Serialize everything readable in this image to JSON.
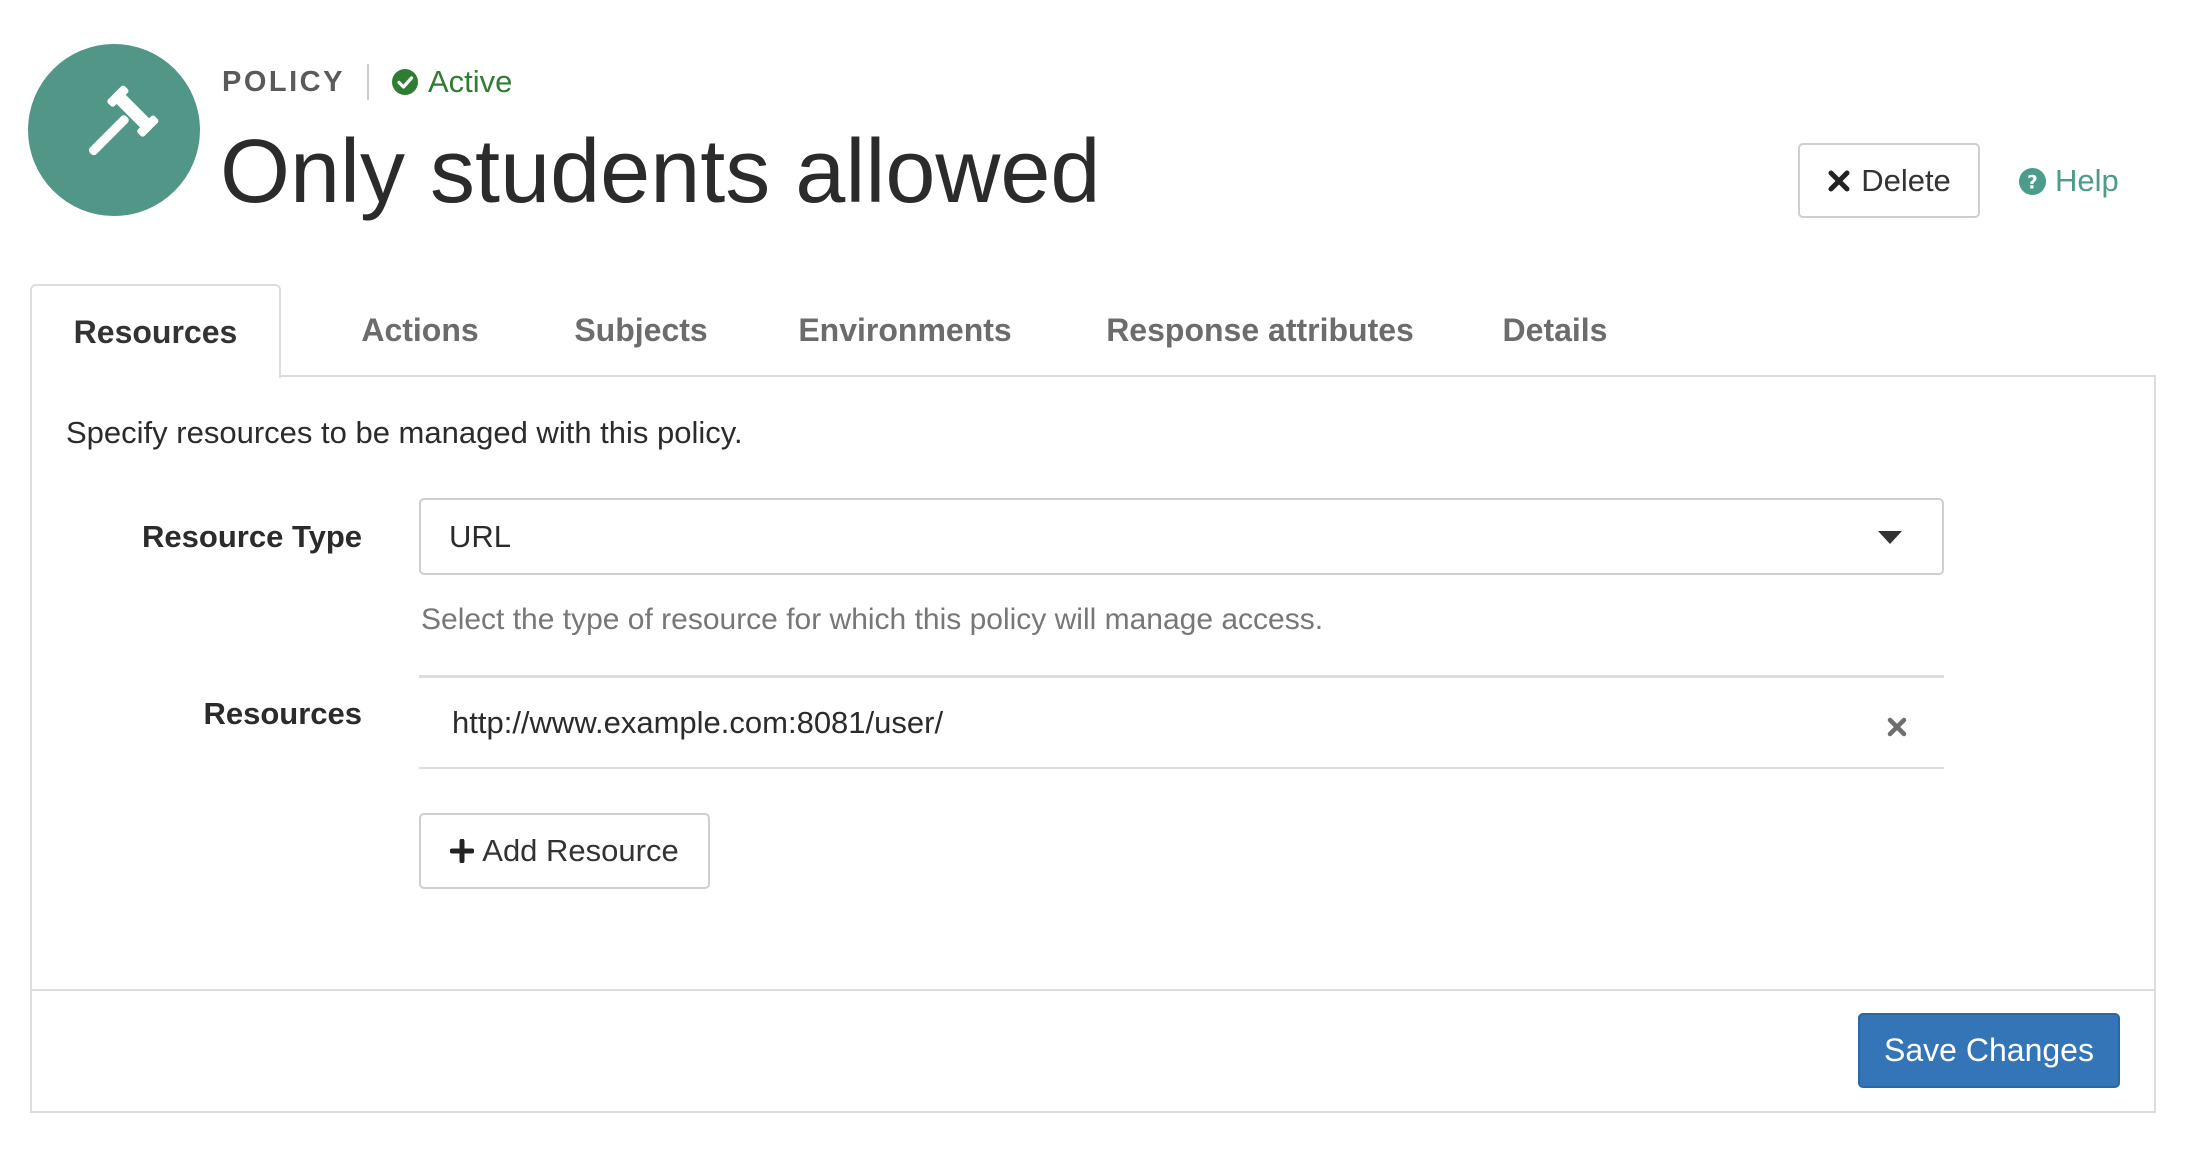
{
  "header": {
    "type_label": "POLICY",
    "status": "Active",
    "title": "Only students allowed",
    "delete_label": "Delete",
    "help_label": "Help"
  },
  "tabs": [
    {
      "label": "Resources",
      "active": true
    },
    {
      "label": "Actions",
      "active": false
    },
    {
      "label": "Subjects",
      "active": false
    },
    {
      "label": "Environments",
      "active": false
    },
    {
      "label": "Response attributes",
      "active": false
    },
    {
      "label": "Details",
      "active": false
    }
  ],
  "panel": {
    "intro": "Specify resources to be managed with this policy.",
    "resource_type": {
      "label": "Resource Type",
      "selected": "URL",
      "help": "Select the type of resource for which this policy will manage access."
    },
    "resources": {
      "label": "Resources",
      "items": [
        "http://www.example.com:8081/user/"
      ],
      "add_label": "Add Resource"
    },
    "save_label": "Save Changes"
  },
  "colors": {
    "avatar_bg": "#519687",
    "status_green": "#2f7d32",
    "help_teal": "#4b9c8b",
    "primary_blue": "#3375b6"
  },
  "icons": {
    "avatar": "gavel-icon",
    "status": "check-circle-icon",
    "delete": "close-icon",
    "help": "question-circle-icon",
    "remove_resource": "close-icon",
    "add": "plus-icon",
    "dropdown": "caret-down-icon"
  }
}
